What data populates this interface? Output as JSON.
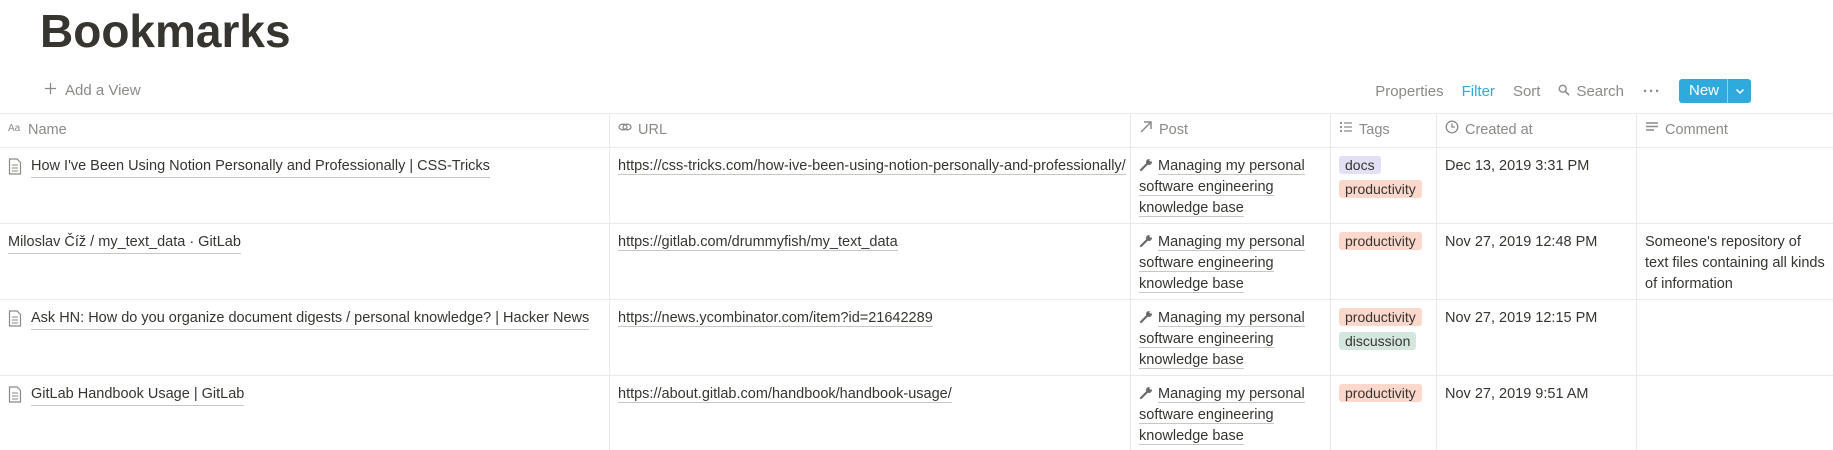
{
  "page": {
    "title": "Bookmarks"
  },
  "toolbar": {
    "add_view": "Add a View",
    "properties": "Properties",
    "filter": "Filter",
    "sort": "Sort",
    "search": "Search",
    "more": "···",
    "new": "New",
    "accent_color": "#2eaadc"
  },
  "columns": {
    "name": "Name",
    "url": "URL",
    "post": "Post",
    "tags": "Tags",
    "created": "Created at",
    "comment": "Comment"
  },
  "rows": [
    {
      "has_doc_icon": true,
      "name": "How I've Been Using Notion Personally and Professionally | CSS-Tricks",
      "url": "https://css-tricks.com/how-ive-been-using-notion-personally-and-professionally/",
      "post": "Managing my personal software engineering knowledge base",
      "tags": [
        "docs",
        "productivity"
      ],
      "created": "Dec 13, 2019 3:31 PM",
      "comment": ""
    },
    {
      "has_doc_icon": false,
      "name": "Miloslav Číž / my_text_data · GitLab",
      "url": "https://gitlab.com/drummyfish/my_text_data",
      "post": "Managing my personal software engineering knowledge base",
      "tags": [
        "productivity"
      ],
      "created": "Nov 27, 2019 12:48 PM",
      "comment": "Someone's repository of text files containing all kinds of information"
    },
    {
      "has_doc_icon": true,
      "name": "Ask HN: How do you organize document digests / personal knowledge? | Hacker News",
      "url": "https://news.ycombinator.com/item?id=21642289",
      "post": "Managing my personal software engineering knowledge base",
      "tags": [
        "productivity",
        "discussion"
      ],
      "created": "Nov 27, 2019 12:15 PM",
      "comment": ""
    },
    {
      "has_doc_icon": true,
      "name": "GitLab Handbook Usage | GitLab",
      "url": "https://about.gitlab.com/handbook/handbook-usage/",
      "post": "Managing my personal software engineering knowledge base",
      "tags": [
        "productivity"
      ],
      "created": "Nov 27, 2019 9:51 AM",
      "comment": ""
    }
  ],
  "tag_colors": {
    "docs": "#e3dff5",
    "productivity": "#fbd7cc",
    "discussion": "#d4e7df"
  }
}
